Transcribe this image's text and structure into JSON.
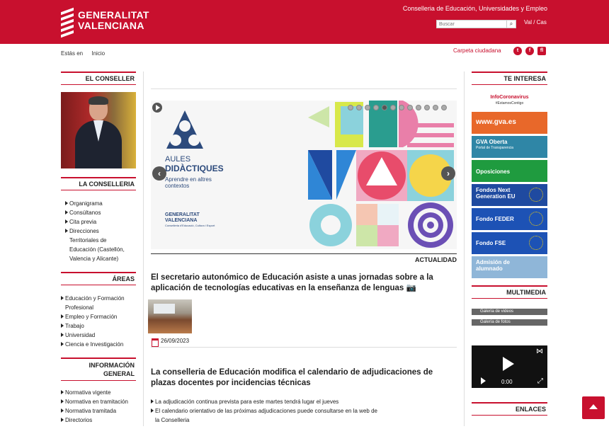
{
  "header": {
    "logo_line1": "GENERALITAT",
    "logo_line2": "VALENCIANA",
    "department": "Conselleria de Educación, Universidades y Empleo",
    "search_placeholder": "Buscar",
    "lang": "Val / Cas"
  },
  "breadcrumb": {
    "label": "Estás en",
    "home": "Inicio"
  },
  "carpeta": "Carpeta ciudadana",
  "social": {
    "twitter": "t",
    "facebook": "f",
    "flickr": "fl"
  },
  "left": {
    "conseller_title": "EL CONSELLER",
    "conselleria_title": "LA CONSELLERIA",
    "conselleria_items": [
      "Organigrama",
      "Consúltanos",
      "Cita previa",
      "Direcciones"
    ],
    "conselleria_sub": [
      "Territoriales de",
      "Educación (Castellón,",
      "Valencia y Alicante)"
    ],
    "areas_title": "ÁREAS",
    "areas_items": [
      "Educación y Formación",
      "Empleo y Formación",
      "Trabajo",
      "Universidad",
      "Ciencia e Investigación"
    ],
    "areas_sub": "Profesional",
    "info_title_1": "INFORMACIÓN",
    "info_title_2": "GENERAL",
    "info_items": [
      "Normativa vigente",
      "Normativa en tramitación",
      "Normativa tramitada",
      "Directorios"
    ]
  },
  "slider": {
    "title_1": "AULES",
    "title_2": "DIDÀCTIQUES",
    "subtitle": "Aprendre en altres contextos",
    "gv_line1": "GENERALITAT",
    "gv_line2": "VALENCIANA",
    "gv_line3": "Conselleria d'Educació, Cultura i Esport",
    "prev": "‹",
    "next": "›"
  },
  "main": {
    "section_label": "ACTUALIDAD",
    "news1_title": "El secretario autonómico de Educación asiste a unas jornadas sobre a la aplicación de tecnologías educativas en la enseñanza de lenguas",
    "news1_date": "26/09/2023",
    "news2_title": "La conselleria de Educación modifica el calendario de adjudicaciones de plazas docentes por incidencias técnicas",
    "news2_bullets": [
      "La adjudicación continua prevista para este martes tendrá lugar el jueves",
      "El calendario orientativo de las próximas adjudicaciones puede consultarse en la web de"
    ],
    "news2_bullet_sub": "la Conselleria"
  },
  "right": {
    "interesa_title": "TE INTERESA",
    "banners": {
      "covid": "InfoCoronavirus",
      "covid_sub": "#EstamosContigo",
      "gva": "www.gva.es",
      "oberta": "GVA Oberta",
      "oberta_sub": "Portal de Transparencia",
      "oposiciones": "Oposiciones",
      "next_1": "Fondos Next",
      "next_2": "Generation EU",
      "feder": "Fondo FEDER",
      "fse": "Fondo FSE",
      "admision_1": "Admisión de",
      "admision_2": "alumnado"
    },
    "multimedia_title": "MULTIMEDIA",
    "galeria_videos": "Galería de videos",
    "galeria_fotos": "Galería de fotos",
    "video_time": "0:00",
    "enlaces_title": "ENLACES"
  },
  "colors": {
    "brand": "#c8102e"
  }
}
